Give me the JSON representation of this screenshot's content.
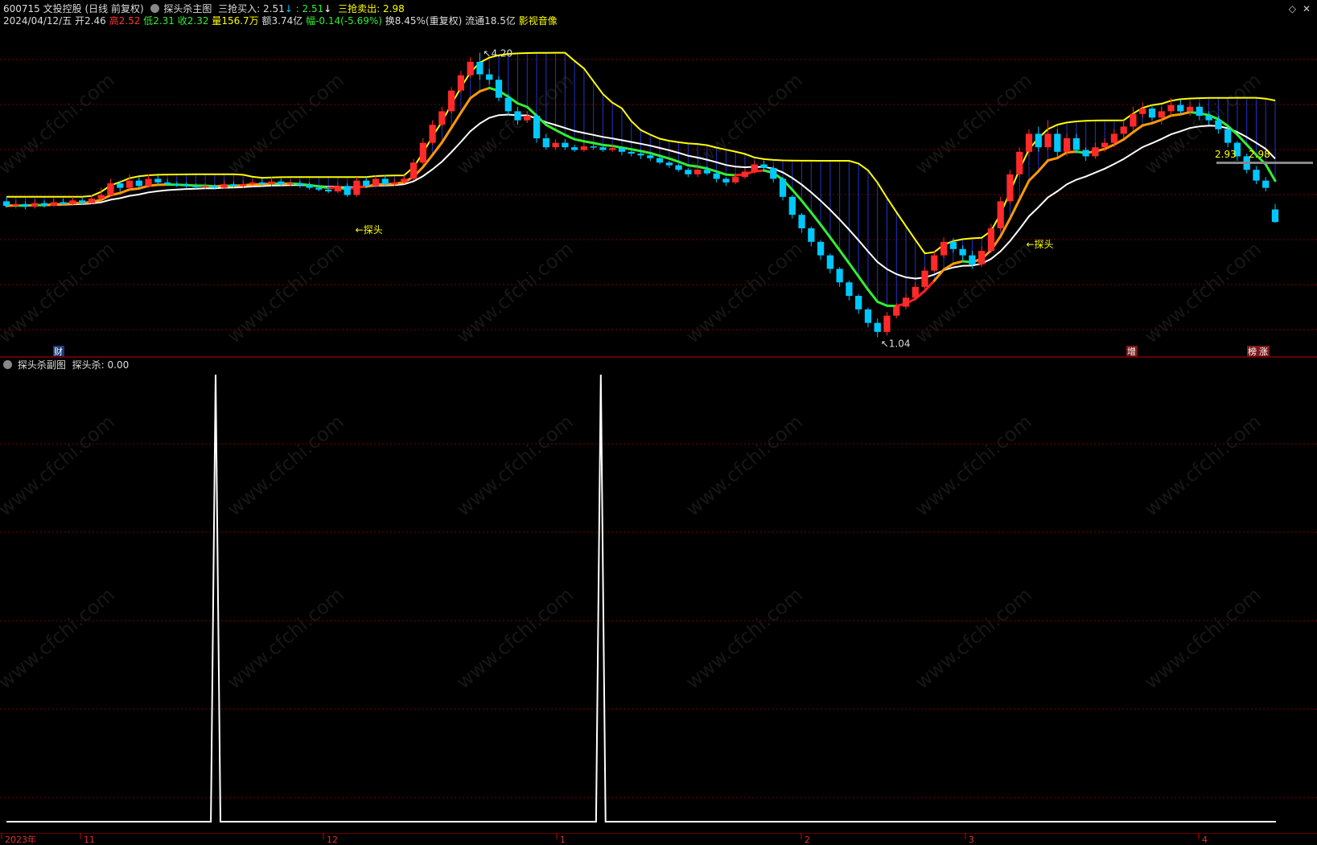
{
  "header": {
    "code": "600715",
    "name": "文投控股",
    "mode": "(日线 前复权)",
    "indicator_name": "探头杀主图",
    "buy_label": "三抢买入:",
    "buy_value1": "2.51",
    "buy_value2": ": 2.51",
    "sell_label": "三抢卖出:",
    "sell_value": "2.98",
    "arrow_down": "↓"
  },
  "quote": {
    "date": "2024/04/12/五",
    "open_label": "开",
    "open": "2.46",
    "high_label": "高",
    "high": "2.52",
    "low_label": "低",
    "low": "2.31",
    "close_label": "收",
    "close": "2.32",
    "vol_label": "量",
    "vol": "156.7万",
    "amt_label": "额",
    "amt": "3.74亿",
    "chg_label": "幅",
    "chg": "-0.14(-5.69%)",
    "turnover": "换8.45%(重复权)",
    "float": "流通18.5亿",
    "sector": "影视音像"
  },
  "main_chart": {
    "annotations": {
      "max_label": "4.20",
      "min_label": "1.04",
      "probe1": "探头",
      "probe2": "←探头",
      "right_val1": "2.93",
      "right_val2": "2.98"
    },
    "badges": {
      "cai": "财",
      "zeng": "增",
      "bang": "榜",
      "zhang": "涨"
    }
  },
  "sub_chart": {
    "title": "探头杀副图",
    "series_label": "探头杀:",
    "series_value": "0.00"
  },
  "axis": {
    "labels": [
      "2023年",
      "11",
      "12",
      "1",
      "2",
      "3",
      "4"
    ]
  },
  "watermark": "www.cfchi.com",
  "colors": {
    "up": "#ff2a2a",
    "down": "#00c8ff",
    "grid": "#7a0000",
    "yellow": "#ffff00",
    "orange": "#ff9a00",
    "green": "#33ee33",
    "white": "#ffffff"
  },
  "chart_data": [
    {
      "type": "candlestick",
      "title": "探头杀主图",
      "series": [
        {
          "name": "三抢买入",
          "values": []
        },
        {
          "name": "三抢卖出",
          "values": []
        }
      ],
      "candles": [
        [
          2.55,
          2.5,
          2.6,
          2.48
        ],
        [
          2.5,
          2.52,
          2.56,
          2.47
        ],
        [
          2.52,
          2.49,
          2.55,
          2.46
        ],
        [
          2.49,
          2.53,
          2.57,
          2.47
        ],
        [
          2.53,
          2.5,
          2.56,
          2.48
        ],
        [
          2.5,
          2.54,
          2.58,
          2.49
        ],
        [
          2.54,
          2.52,
          2.58,
          2.5
        ],
        [
          2.52,
          2.56,
          2.6,
          2.5
        ],
        [
          2.56,
          2.53,
          2.6,
          2.51
        ],
        [
          2.53,
          2.58,
          2.62,
          2.52
        ],
        [
          2.58,
          2.62,
          2.7,
          2.56
        ],
        [
          2.62,
          2.75,
          2.8,
          2.6
        ],
        [
          2.75,
          2.7,
          2.78,
          2.66
        ],
        [
          2.7,
          2.78,
          2.85,
          2.68
        ],
        [
          2.78,
          2.72,
          2.82,
          2.7
        ],
        [
          2.72,
          2.8,
          2.85,
          2.7
        ],
        [
          2.8,
          2.76,
          2.84,
          2.73
        ],
        [
          2.76,
          2.74,
          2.8,
          2.72
        ],
        [
          2.74,
          2.73,
          2.77,
          2.71
        ],
        [
          2.73,
          2.72,
          2.76,
          2.7
        ],
        [
          2.72,
          2.71,
          2.75,
          2.69
        ],
        [
          2.71,
          2.72,
          2.75,
          2.69
        ],
        [
          2.72,
          2.7,
          2.74,
          2.68
        ],
        [
          2.7,
          2.74,
          2.78,
          2.69
        ],
        [
          2.74,
          2.72,
          2.77,
          2.7
        ],
        [
          2.72,
          2.74,
          2.78,
          2.7
        ],
        [
          2.74,
          2.76,
          2.8,
          2.72
        ],
        [
          2.76,
          2.74,
          2.8,
          2.72
        ],
        [
          2.74,
          2.77,
          2.82,
          2.72
        ],
        [
          2.77,
          2.74,
          2.8,
          2.72
        ],
        [
          2.74,
          2.75,
          2.79,
          2.72
        ],
        [
          2.75,
          2.73,
          2.78,
          2.7
        ],
        [
          2.73,
          2.7,
          2.76,
          2.68
        ],
        [
          2.7,
          2.68,
          2.73,
          2.66
        ],
        [
          2.68,
          2.66,
          2.71,
          2.64
        ],
        [
          2.66,
          2.72,
          2.76,
          2.64
        ],
        [
          2.72,
          2.62,
          2.75,
          2.6
        ],
        [
          2.62,
          2.78,
          2.82,
          2.6
        ],
        [
          2.78,
          2.72,
          2.82,
          2.7
        ],
        [
          2.72,
          2.8,
          2.84,
          2.7
        ],
        [
          2.8,
          2.74,
          2.84,
          2.72
        ],
        [
          2.74,
          2.76,
          2.8,
          2.72
        ],
        [
          2.76,
          2.8,
          2.84,
          2.74
        ],
        [
          2.8,
          2.98,
          3.02,
          2.78
        ],
        [
          2.98,
          3.2,
          3.25,
          2.96
        ],
        [
          3.2,
          3.4,
          3.45,
          3.18
        ],
        [
          3.4,
          3.55,
          3.6,
          3.38
        ],
        [
          3.55,
          3.78,
          3.82,
          3.52
        ],
        [
          3.78,
          3.95,
          4.0,
          3.75
        ],
        [
          3.95,
          4.1,
          4.15,
          3.92
        ],
        [
          4.1,
          3.96,
          4.2,
          3.9
        ],
        [
          3.96,
          3.9,
          4.02,
          3.85
        ],
        [
          3.9,
          3.7,
          3.94,
          3.66
        ],
        [
          3.7,
          3.55,
          3.74,
          3.5
        ],
        [
          3.55,
          3.45,
          3.6,
          3.4
        ],
        [
          3.45,
          3.5,
          3.55,
          3.42
        ],
        [
          3.5,
          3.25,
          3.52,
          3.2
        ],
        [
          3.25,
          3.15,
          3.3,
          3.12
        ],
        [
          3.15,
          3.2,
          3.24,
          3.12
        ],
        [
          3.2,
          3.15,
          3.24,
          3.12
        ],
        [
          3.15,
          3.12,
          3.18,
          3.1
        ],
        [
          3.12,
          3.16,
          3.2,
          3.1
        ],
        [
          3.16,
          3.15,
          3.19,
          3.12
        ],
        [
          3.15,
          3.12,
          3.18,
          3.1
        ],
        [
          3.12,
          3.14,
          3.18,
          3.1
        ],
        [
          3.14,
          3.1,
          3.16,
          3.06
        ],
        [
          3.1,
          3.08,
          3.12,
          3.05
        ],
        [
          3.08,
          3.06,
          3.1,
          3.02
        ],
        [
          3.06,
          3.03,
          3.08,
          3.0
        ],
        [
          3.03,
          2.98,
          3.05,
          2.96
        ],
        [
          2.98,
          2.95,
          3.0,
          2.92
        ],
        [
          2.95,
          2.9,
          2.97,
          2.88
        ],
        [
          2.9,
          2.85,
          2.92,
          2.82
        ],
        [
          2.85,
          2.9,
          2.94,
          2.82
        ],
        [
          2.9,
          2.86,
          2.94,
          2.84
        ],
        [
          2.86,
          2.8,
          2.88,
          2.76
        ],
        [
          2.8,
          2.76,
          2.82,
          2.72
        ],
        [
          2.76,
          2.82,
          2.86,
          2.74
        ],
        [
          2.82,
          2.88,
          2.92,
          2.8
        ],
        [
          2.88,
          2.96,
          3.0,
          2.86
        ],
        [
          2.96,
          2.92,
          3.0,
          2.9
        ],
        [
          2.92,
          2.8,
          2.94,
          2.76
        ],
        [
          2.8,
          2.6,
          2.82,
          2.56
        ],
        [
          2.6,
          2.4,
          2.62,
          2.36
        ],
        [
          2.4,
          2.25,
          2.42,
          2.2
        ],
        [
          2.25,
          2.1,
          2.27,
          2.05
        ],
        [
          2.1,
          1.95,
          2.12,
          1.9
        ],
        [
          1.95,
          1.8,
          1.97,
          1.75
        ],
        [
          1.8,
          1.65,
          1.82,
          1.6
        ],
        [
          1.65,
          1.5,
          1.67,
          1.45
        ],
        [
          1.5,
          1.35,
          1.52,
          1.3
        ],
        [
          1.35,
          1.2,
          1.37,
          1.15
        ],
        [
          1.2,
          1.1,
          1.25,
          1.04
        ],
        [
          1.1,
          1.28,
          1.32,
          1.06
        ],
        [
          1.28,
          1.38,
          1.42,
          1.25
        ],
        [
          1.38,
          1.48,
          1.52,
          1.35
        ],
        [
          1.48,
          1.6,
          1.65,
          1.45
        ],
        [
          1.6,
          1.78,
          1.82,
          1.58
        ],
        [
          1.78,
          1.95,
          2.0,
          1.76
        ],
        [
          1.95,
          2.1,
          2.15,
          1.92
        ],
        [
          2.1,
          2.02,
          2.14,
          1.98
        ],
        [
          2.02,
          1.95,
          2.06,
          1.9
        ],
        [
          1.95,
          1.85,
          2.0,
          1.8
        ],
        [
          1.85,
          2.0,
          2.05,
          1.82
        ],
        [
          2.0,
          2.25,
          2.3,
          1.98
        ],
        [
          2.25,
          2.55,
          2.6,
          2.22
        ],
        [
          2.55,
          2.85,
          2.9,
          2.52
        ],
        [
          2.85,
          3.1,
          3.15,
          2.82
        ],
        [
          3.1,
          3.3,
          3.35,
          3.05
        ],
        [
          3.3,
          3.15,
          3.38,
          3.1
        ],
        [
          3.15,
          3.3,
          3.45,
          3.12
        ],
        [
          3.3,
          3.1,
          3.35,
          3.05
        ],
        [
          3.1,
          3.25,
          3.3,
          3.05
        ],
        [
          3.25,
          3.12,
          3.3,
          3.08
        ],
        [
          3.12,
          3.05,
          3.15,
          3.0
        ],
        [
          3.05,
          3.15,
          3.2,
          3.02
        ],
        [
          3.15,
          3.2,
          3.25,
          3.1
        ],
        [
          3.2,
          3.3,
          3.35,
          3.15
        ],
        [
          3.3,
          3.38,
          3.45,
          3.25
        ],
        [
          3.38,
          3.52,
          3.6,
          3.35
        ],
        [
          3.52,
          3.58,
          3.65,
          3.48
        ],
        [
          3.58,
          3.48,
          3.62,
          3.45
        ],
        [
          3.48,
          3.55,
          3.6,
          3.4
        ],
        [
          3.55,
          3.62,
          3.7,
          3.5
        ],
        [
          3.62,
          3.55,
          3.68,
          3.52
        ],
        [
          3.55,
          3.6,
          3.65,
          3.5
        ],
        [
          3.6,
          3.5,
          3.64,
          3.45
        ],
        [
          3.5,
          3.45,
          3.55,
          3.4
        ],
        [
          3.45,
          3.35,
          3.5,
          3.3
        ],
        [
          3.35,
          3.2,
          3.38,
          3.15
        ],
        [
          3.2,
          3.05,
          3.22,
          3.0
        ],
        [
          3.05,
          2.9,
          3.08,
          2.86
        ],
        [
          2.9,
          2.78,
          2.94,
          2.74
        ],
        [
          2.78,
          2.7,
          2.82,
          2.66
        ],
        [
          2.46,
          2.32,
          2.52,
          2.31
        ]
      ]
    },
    {
      "type": "line",
      "title": "探头杀副图",
      "series": [
        {
          "name": "探头杀",
          "values": [
            0,
            0,
            0,
            0,
            0,
            0,
            0,
            0,
            0,
            0,
            0,
            0,
            0,
            0,
            0,
            0,
            0,
            0,
            0,
            0,
            0,
            0,
            0,
            0,
            0,
            0,
            0,
            0,
            0,
            0,
            0,
            0,
            0,
            0,
            0,
            0,
            0,
            0,
            0,
            0,
            0,
            0,
            0,
            0,
            1,
            0,
            0,
            0,
            0,
            0,
            0,
            0,
            0,
            0,
            0,
            0,
            0,
            0,
            0,
            0,
            0,
            0,
            0,
            0,
            0,
            0,
            0,
            0,
            0,
            0,
            0,
            0,
            0,
            0,
            0,
            0,
            0,
            0,
            0,
            0,
            0,
            0,
            0,
            0,
            0,
            0,
            0,
            0,
            0,
            0,
            0,
            0,
            0,
            0,
            0,
            0,
            0,
            0,
            0,
            0,
            0,
            0,
            0,
            0,
            0,
            0,
            0,
            0,
            0,
            0,
            0,
            0,
            0,
            0,
            0,
            0,
            0,
            0,
            0,
            0,
            0,
            0,
            0,
            0,
            0,
            1,
            0,
            0,
            0,
            0,
            0,
            0,
            0,
            0,
            0,
            0,
            0,
            0,
            0,
            0,
            0,
            0,
            0,
            0,
            0,
            0,
            0,
            0,
            0,
            0,
            0,
            0,
            0,
            0,
            0,
            0,
            0,
            0,
            0,
            0,
            0,
            0,
            0,
            0,
            0,
            0,
            0,
            0,
            0,
            0,
            0,
            0,
            0,
            0,
            0,
            0,
            0,
            0,
            0,
            0,
            0,
            0,
            0,
            0,
            0,
            0,
            0,
            0,
            0,
            0,
            0,
            0,
            0,
            0,
            0,
            0,
            0,
            0,
            0,
            0,
            0,
            0,
            0,
            0,
            0,
            0,
            0,
            0,
            0,
            0,
            0,
            0,
            0,
            0,
            0,
            0,
            0,
            0,
            0,
            0,
            0,
            0,
            0,
            0,
            0,
            0,
            0,
            0,
            0,
            0,
            0,
            0,
            0,
            0,
            0,
            0,
            0,
            0,
            0,
            0,
            0,
            0,
            0,
            0,
            0,
            0,
            0,
            0,
            0,
            0,
            0,
            0,
            0,
            0,
            0,
            0,
            0,
            0,
            0,
            0,
            0,
            0,
            0,
            0,
            0,
            0,
            0,
            0
          ]
        }
      ],
      "ylim": [
        0,
        1
      ]
    }
  ]
}
